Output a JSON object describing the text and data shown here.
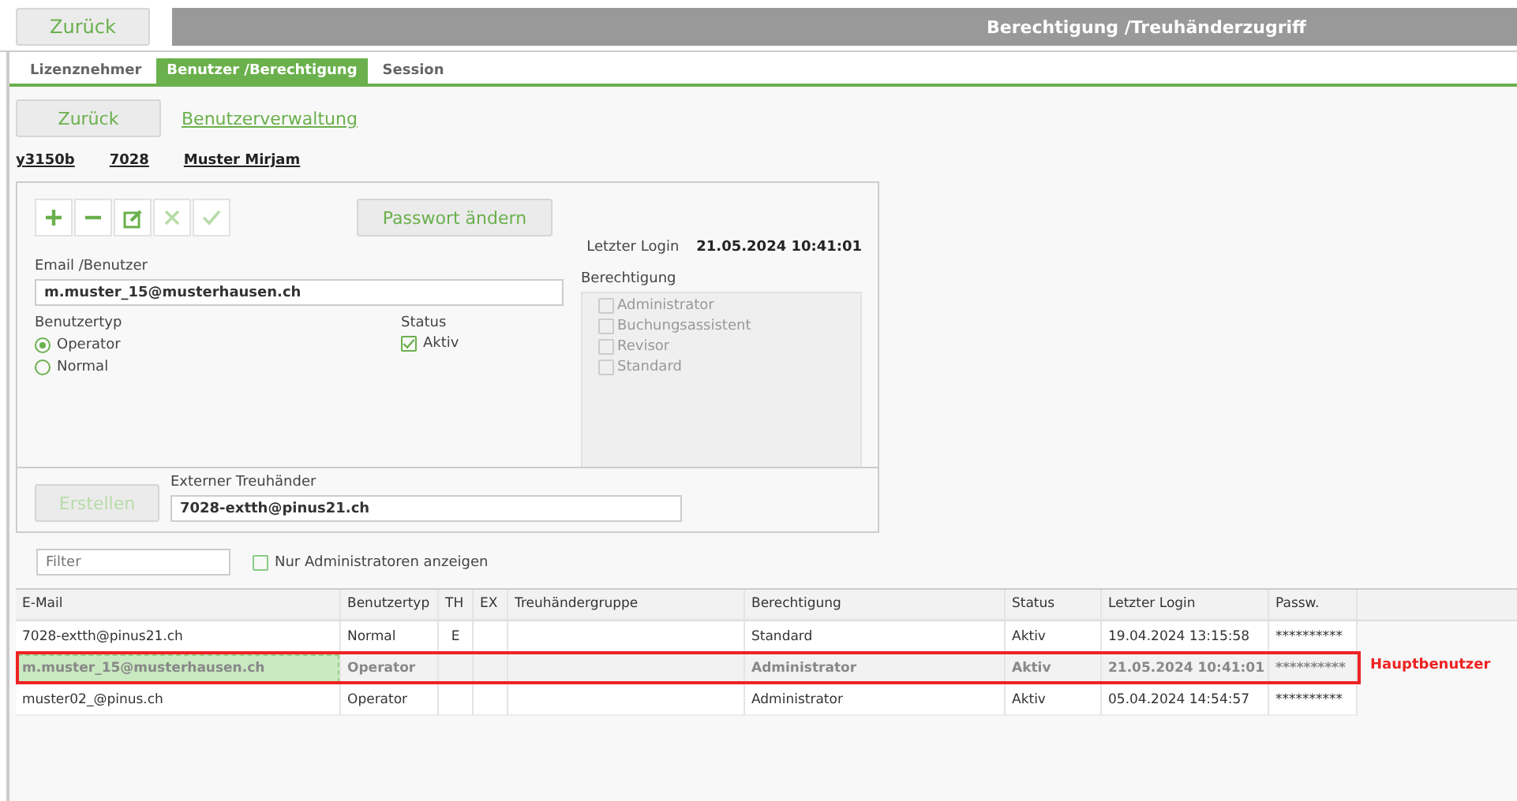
{
  "header": {
    "back_button": "Zurück",
    "title": "Berechtigung /Treuhänderzugriff"
  },
  "tabs": [
    {
      "label": "Lizenznehmer",
      "selected": false
    },
    {
      "label": "Benutzer /Berechtigung",
      "selected": true
    },
    {
      "label": "Session",
      "selected": false
    }
  ],
  "back_button": "Zurück",
  "breadcrumb_link": "Benutzerverwaltung",
  "info": [
    "y3150b",
    "7028",
    "Muster Mirjam"
  ],
  "toolbar": [
    {
      "kind": "add",
      "disabled": false
    },
    {
      "kind": "remove",
      "disabled": false
    },
    {
      "kind": "edit",
      "disabled": false
    },
    {
      "kind": "cancel",
      "disabled": true
    },
    {
      "kind": "confirm",
      "disabled": true
    }
  ],
  "password_button": "Passwort ändern",
  "last_login": {
    "label": "Letzter Login",
    "value": "21.05.2024 10:41:01"
  },
  "email": {
    "label": "Email /Benutzer",
    "value": "m.muster_15@musterhausen.ch"
  },
  "user_type": {
    "label": "Benutzertyp",
    "options": [
      {
        "label": "Operator",
        "selected": true
      },
      {
        "label": "Normal",
        "selected": false
      }
    ]
  },
  "status": {
    "label": "Status",
    "checkbox": {
      "label": "Aktiv",
      "checked": true
    }
  },
  "permissions": {
    "label": "Berechtigung",
    "disabled": true,
    "options": [
      {
        "label": "Administrator",
        "checked": false
      },
      {
        "label": "Buchungsassistent",
        "checked": false
      },
      {
        "label": "Revisor",
        "checked": false
      },
      {
        "label": "Standard",
        "checked": false
      }
    ]
  },
  "create_button": {
    "label": "Erstellen",
    "disabled": true
  },
  "external_trustee": {
    "label": "Externer Treuhänder",
    "value": "7028-extth@pinus21.ch"
  },
  "filter": {
    "placeholder": "Filter"
  },
  "admins_only": {
    "label": "Nur Administratoren anzeigen",
    "checked": false
  },
  "table": {
    "columns": [
      "E-Mail",
      "Benutzertyp",
      "TH",
      "EX",
      "Treuhändergruppe",
      "Berechtigung",
      "Status",
      "Letzter Login",
      "Passw."
    ],
    "rows": [
      {
        "selected": false,
        "outlined": false,
        "cells": [
          "7028-extth@pinus21.ch",
          "Normal",
          "E",
          "",
          "",
          "Standard",
          "Aktiv",
          "19.04.2024 13:15:58",
          "**********"
        ]
      },
      {
        "selected": true,
        "outlined": true,
        "cells": [
          "m.muster_15@musterhausen.ch",
          "Operator",
          "",
          "",
          "",
          "Administrator",
          "Aktiv",
          "21.05.2024 10:41:01",
          "**********"
        ]
      },
      {
        "selected": false,
        "outlined": false,
        "cells": [
          "muster02_@pinus.ch",
          "Operator",
          "",
          "",
          "",
          "Administrator",
          "Aktiv",
          "05.04.2024 14:54:57",
          "**********"
        ]
      }
    ]
  },
  "annotation": "Hauptbenutzer"
}
